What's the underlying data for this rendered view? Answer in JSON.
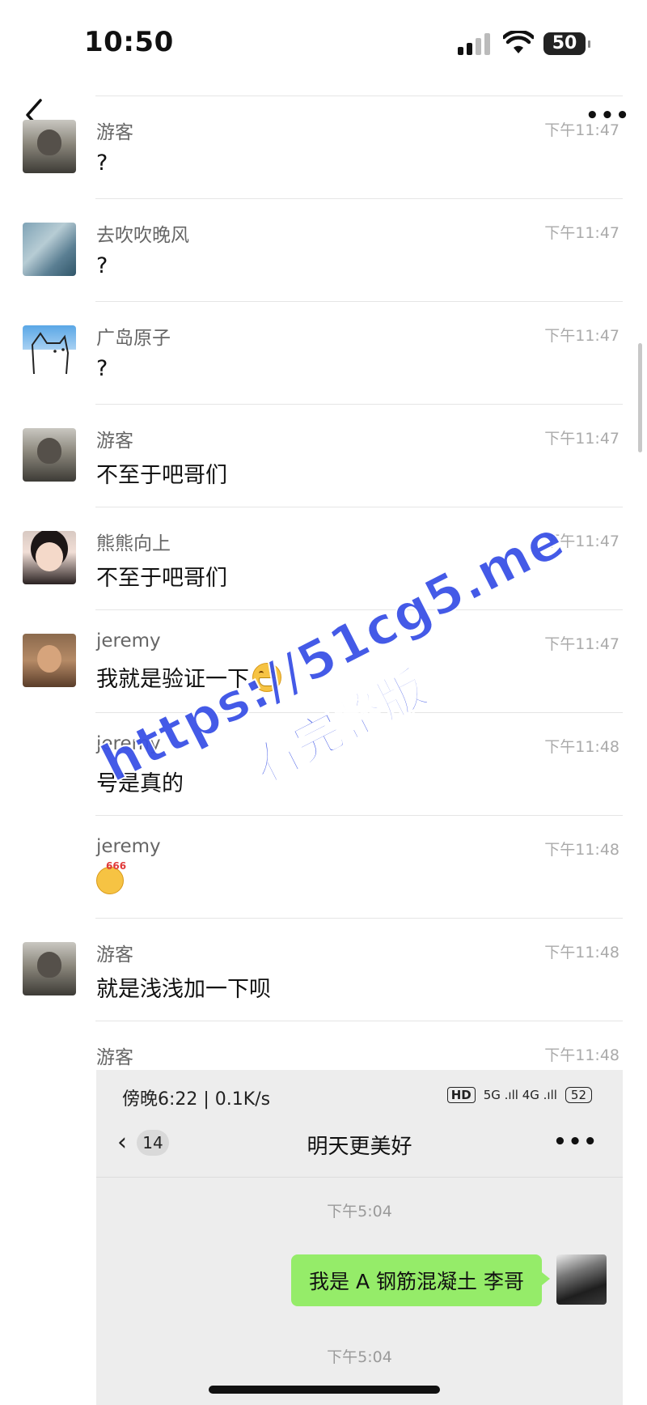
{
  "status": {
    "time": "10:50",
    "battery": "50"
  },
  "messages": [
    {
      "name": "游客",
      "time": "下午11:47",
      "text": "?"
    },
    {
      "name": "去吹吹晚风",
      "time": "下午11:47",
      "text": "?"
    },
    {
      "name": "广岛原子",
      "time": "下午11:47",
      "text": "?"
    },
    {
      "name": "游客",
      "time": "下午11:47",
      "text": "不至于吧哥们"
    },
    {
      "name": "熊熊向上",
      "time": "下午11:47",
      "text": "不至于吧哥们"
    },
    {
      "name": "jeremy",
      "time": "下午11:47",
      "text": "我就是验证一下"
    },
    {
      "name": "jeremy",
      "time": "下午11:48",
      "text": "号是真的"
    },
    {
      "name": "jeremy",
      "time": "下午11:48",
      "sticker_num": "666"
    },
    {
      "name": "游客",
      "time": "下午11:48",
      "text": "就是浅浅加一下呗"
    },
    {
      "name": "游客",
      "time": "下午11:48"
    }
  ],
  "embedded": {
    "status_left": "傍晚6:22 | 0.1K/s",
    "hd": "HD",
    "network": "5G .ıll 4G .ıll",
    "battery": "52",
    "unread_count": "14",
    "title": "明天更美好",
    "time1": "下午5:04",
    "bubble_text": "我是 A 钢筋混凝土 李哥",
    "time2": "下午5:04"
  },
  "watermark": {
    "line1": "https://51cg5.me",
    "line2": "看完整版"
  }
}
